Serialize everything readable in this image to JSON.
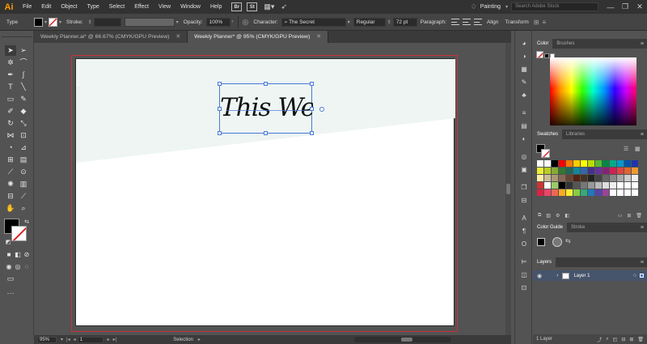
{
  "app": {
    "logo": "Ai",
    "menus": [
      "File",
      "Edit",
      "Object",
      "Type",
      "Select",
      "Effect",
      "View",
      "Window",
      "Help"
    ],
    "bridge": "Br",
    "bridge_st": "St",
    "workspace": "Painting",
    "stock_placeholder": "Search Adobe Stock",
    "window_controls": {
      "minimize": "—",
      "maximize": "❐",
      "close": "✕"
    }
  },
  "control_bar": {
    "type_label": "Type",
    "stroke_label": "Stroke:",
    "opacity_label": "Opacity:",
    "opacity_value": "100%",
    "character_label": "Character:",
    "font_name": "The Secret",
    "font_style": "Regular",
    "font_size": "72 pt",
    "paragraph_label": "Paragraph:",
    "align_label": "Align",
    "transform_label": "Transform"
  },
  "tabs": [
    {
      "label": "Weekly Planner.ai* @ 66.67% (CMYK/GPU Preview)",
      "active": false
    },
    {
      "label": "Weekly Planner* @ 95% (CMYK/GPU Preview)",
      "active": true
    }
  ],
  "tab_close": "✕",
  "artboard": {
    "text": "This Week",
    "band_color": "#eef5f3",
    "bleed_color": "#c8323a"
  },
  "status": {
    "zoom": "95%",
    "page": "1",
    "tool": "Selection"
  },
  "panels": {
    "color": {
      "tabs": [
        "Color",
        "Brushes"
      ]
    },
    "swatches": {
      "tabs": [
        "Swatches",
        "Libraries"
      ],
      "rows": [
        [
          "#ffffff",
          "#ffffff",
          "#000000",
          "#ff0000",
          "#ff7700",
          "#ffcc00",
          "#ffff00",
          "#bbdd00",
          "#55bb33",
          "#008844",
          "#00aa88",
          "#0099cc",
          "#0055aa",
          "#2233aa"
        ],
        [
          "#eeee33",
          "#bbcc22",
          "#88aa33",
          "#337733",
          "#226655",
          "#118899",
          "#3366aa",
          "#443388",
          "#663399",
          "#882277",
          "#cc2255",
          "#dd4444",
          "#dd6633",
          "#ee9933"
        ],
        [
          "#ffeeaa",
          "#ccbb99",
          "#aa9977",
          "#886655",
          "#664433",
          "#552211",
          "#443322",
          "#222222",
          "#444444",
          "#666666",
          "#888888",
          "#aaaaaa",
          "#cccccc",
          "#eeeeee"
        ],
        [
          "#cc3333",
          "#ffffff",
          "#99cc66",
          "#000000",
          "#333333",
          "#555555",
          "#777777",
          "#999999",
          "#bbbbbb",
          "#dddddd",
          "#eeeeee",
          "#ffffff",
          "#ffffff",
          "#ffffff"
        ],
        [
          "#dd2244",
          "#ee4466",
          "#ee6655",
          "#ffaa22",
          "#ffee33",
          "#88cc44",
          "#33aa77",
          "#2277bb",
          "#5544aa",
          "#994499",
          "#ffffff",
          "#ffffff",
          "#ffffff",
          "#ffffff"
        ]
      ]
    },
    "color_guide": {
      "tabs": [
        "Color Guide",
        "Stroke"
      ]
    },
    "layers": {
      "tab": "Layers",
      "items": [
        {
          "name": "Layer 1"
        }
      ],
      "footer": "1 Layer"
    }
  }
}
